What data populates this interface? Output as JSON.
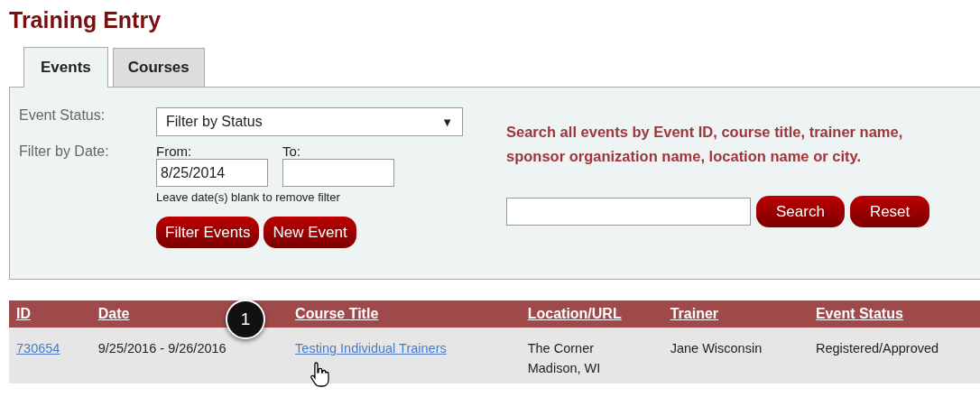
{
  "page_title": "Training Entry",
  "tabs": [
    {
      "label": "Events",
      "selected": true
    },
    {
      "label": "Courses",
      "selected": false
    }
  ],
  "filters": {
    "status_label": "Event Status:",
    "status_value": "Filter by Status",
    "status_caret": "▼",
    "date_label": "Filter by Date:",
    "from_label": "From:",
    "from_value": "8/25/2014",
    "to_label": "To:",
    "hint": "Leave date(s) blank to remove filter",
    "buttons": [
      "Filter Events",
      "New Event"
    ]
  },
  "search": {
    "description": "Search all events by Event ID, course title, trainer name, sponsor organization name, location name or city.",
    "buttons": [
      "Search",
      "Reset"
    ]
  },
  "step_marker": "1",
  "table": {
    "columns": [
      "ID",
      "Date",
      "Course Title",
      "Location/URL",
      "Trainer",
      "Event Status"
    ],
    "rows": [
      {
        "id": "730654",
        "date": "9/25/2016 - 9/26/2016",
        "course_title": "Testing Individual Trainers",
        "location": [
          "The Corner",
          "Madison, WI"
        ],
        "trainer": "Jane Wisconsin",
        "status": "Registered/Approved"
      }
    ]
  }
}
